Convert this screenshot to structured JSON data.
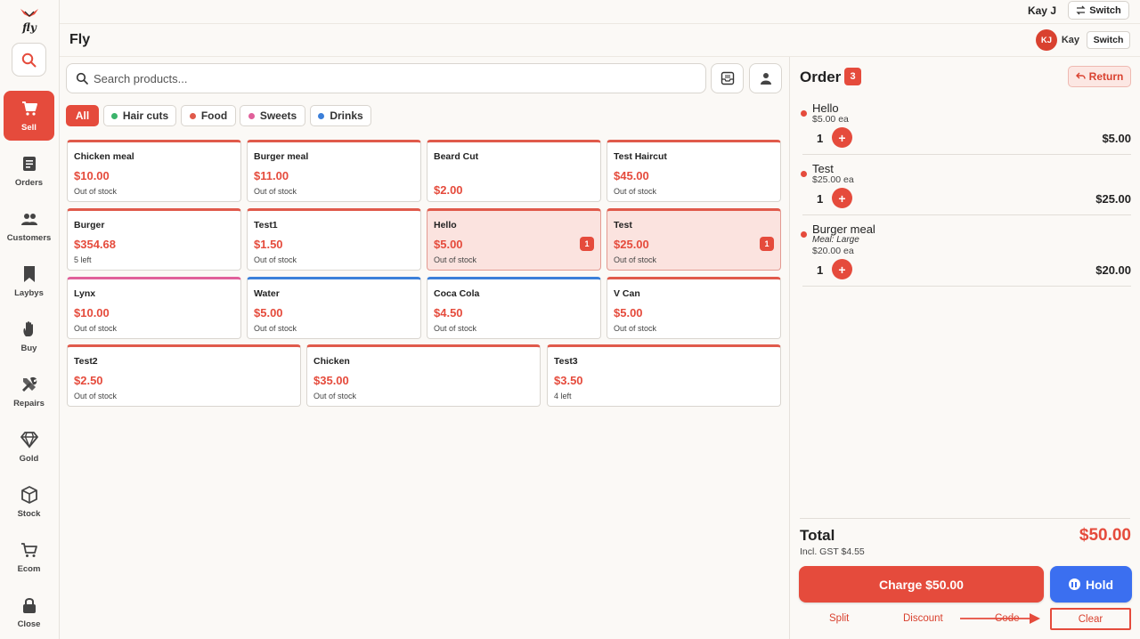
{
  "app": {
    "brand_logo_text": "fly",
    "store_name": "Fly",
    "top_user": "Kay J",
    "top_switch_label": "Switch",
    "avatar_initials": "KJ",
    "header_user": "Kay",
    "header_switch_label": "Switch",
    "accent_color": "#e54b3c",
    "hold_color": "#3b6ff0"
  },
  "nav": {
    "items": [
      {
        "label": "Sell",
        "icon": "cart-icon",
        "active": true
      },
      {
        "label": "Orders",
        "icon": "orders-icon"
      },
      {
        "label": "Customers",
        "icon": "customers-icon"
      },
      {
        "label": "Laybys",
        "icon": "bookmark-icon"
      },
      {
        "label": "Buy",
        "icon": "hand-icon"
      },
      {
        "label": "Repairs",
        "icon": "tools-icon"
      },
      {
        "label": "Gold",
        "icon": "diamond-icon"
      },
      {
        "label": "Stock",
        "icon": "box-icon"
      },
      {
        "label": "Ecom",
        "icon": "ecom-cart-icon"
      },
      {
        "label": "Close",
        "icon": "lock-icon"
      }
    ]
  },
  "search": {
    "placeholder": "Search products..."
  },
  "filters": [
    {
      "label": "All",
      "active": true
    },
    {
      "label": "Hair cuts",
      "dot_color": "#3bb36b"
    },
    {
      "label": "Food",
      "dot_color": "#e05a4b"
    },
    {
      "label": "Sweets",
      "dot_color": "#e0609a"
    },
    {
      "label": "Drinks",
      "dot_color": "#3b7fd9"
    }
  ],
  "products": [
    {
      "name": "Chicken meal",
      "price": "$10.00",
      "stock": "Out of stock",
      "accent": "#e05a4b"
    },
    {
      "name": "Burger meal",
      "price": "$11.00",
      "stock": "Out of stock",
      "accent": "#e05a4b"
    },
    {
      "name": "Beard Cut",
      "price": "$2.00",
      "stock": "",
      "accent": "#e05a4b"
    },
    {
      "name": "Test Haircut",
      "price": "$45.00",
      "stock": "Out of stock",
      "accent": "#e05a4b"
    },
    {
      "name": "Burger",
      "price": "$354.68",
      "stock": "5 left",
      "accent": "#e05a4b"
    },
    {
      "name": "Test1",
      "price": "$1.50",
      "stock": "Out of stock",
      "accent": "#e05a4b"
    },
    {
      "name": "Hello",
      "price": "$5.00",
      "stock": "Out of stock",
      "accent": "#e05a4b",
      "in_cart": "1"
    },
    {
      "name": "Test",
      "price": "$25.00",
      "stock": "Out of stock",
      "accent": "#e05a4b",
      "in_cart": "1"
    },
    {
      "name": "Lynx",
      "price": "$10.00",
      "stock": "Out of stock",
      "accent": "#e0609a"
    },
    {
      "name": "Water",
      "price": "$5.00",
      "stock": "Out of stock",
      "accent": "#3b7fd9"
    },
    {
      "name": "Coca Cola",
      "price": "$4.50",
      "stock": "Out of stock",
      "accent": "#3b7fd9"
    },
    {
      "name": "V Can",
      "price": "$5.00",
      "stock": "Out of stock",
      "accent": "#e05a4b"
    },
    {
      "name": "Test2",
      "price": "$2.50",
      "stock": "Out of stock",
      "accent": "#e05a4b"
    },
    {
      "name": "Chicken",
      "price": "$35.00",
      "stock": "Out of stock",
      "accent": "#e05a4b"
    },
    {
      "name": "Test3",
      "price": "$3.50",
      "stock": "4 left",
      "accent": "#e05a4b"
    }
  ],
  "order": {
    "title": "Order",
    "count": "3",
    "return_label": "Return",
    "items": [
      {
        "name": "Hello",
        "modifier": "",
        "each": "$5.00 ea",
        "qty": "1",
        "total": "$5.00"
      },
      {
        "name": "Test",
        "modifier": "",
        "each": "$25.00 ea",
        "qty": "1",
        "total": "$25.00"
      },
      {
        "name": "Burger meal",
        "modifier": "Meal: Large",
        "each": "$20.00 ea",
        "qty": "1",
        "total": "$20.00"
      }
    ],
    "total_label": "Total",
    "gst": "Incl. GST $4.55",
    "total_value": "$50.00",
    "charge_label": "Charge $50.00",
    "hold_label": "Hold",
    "split_label": "Split",
    "discount_label": "Discount",
    "code_label": "Code",
    "clear_label": "Clear",
    "plus_symbol": "+"
  }
}
